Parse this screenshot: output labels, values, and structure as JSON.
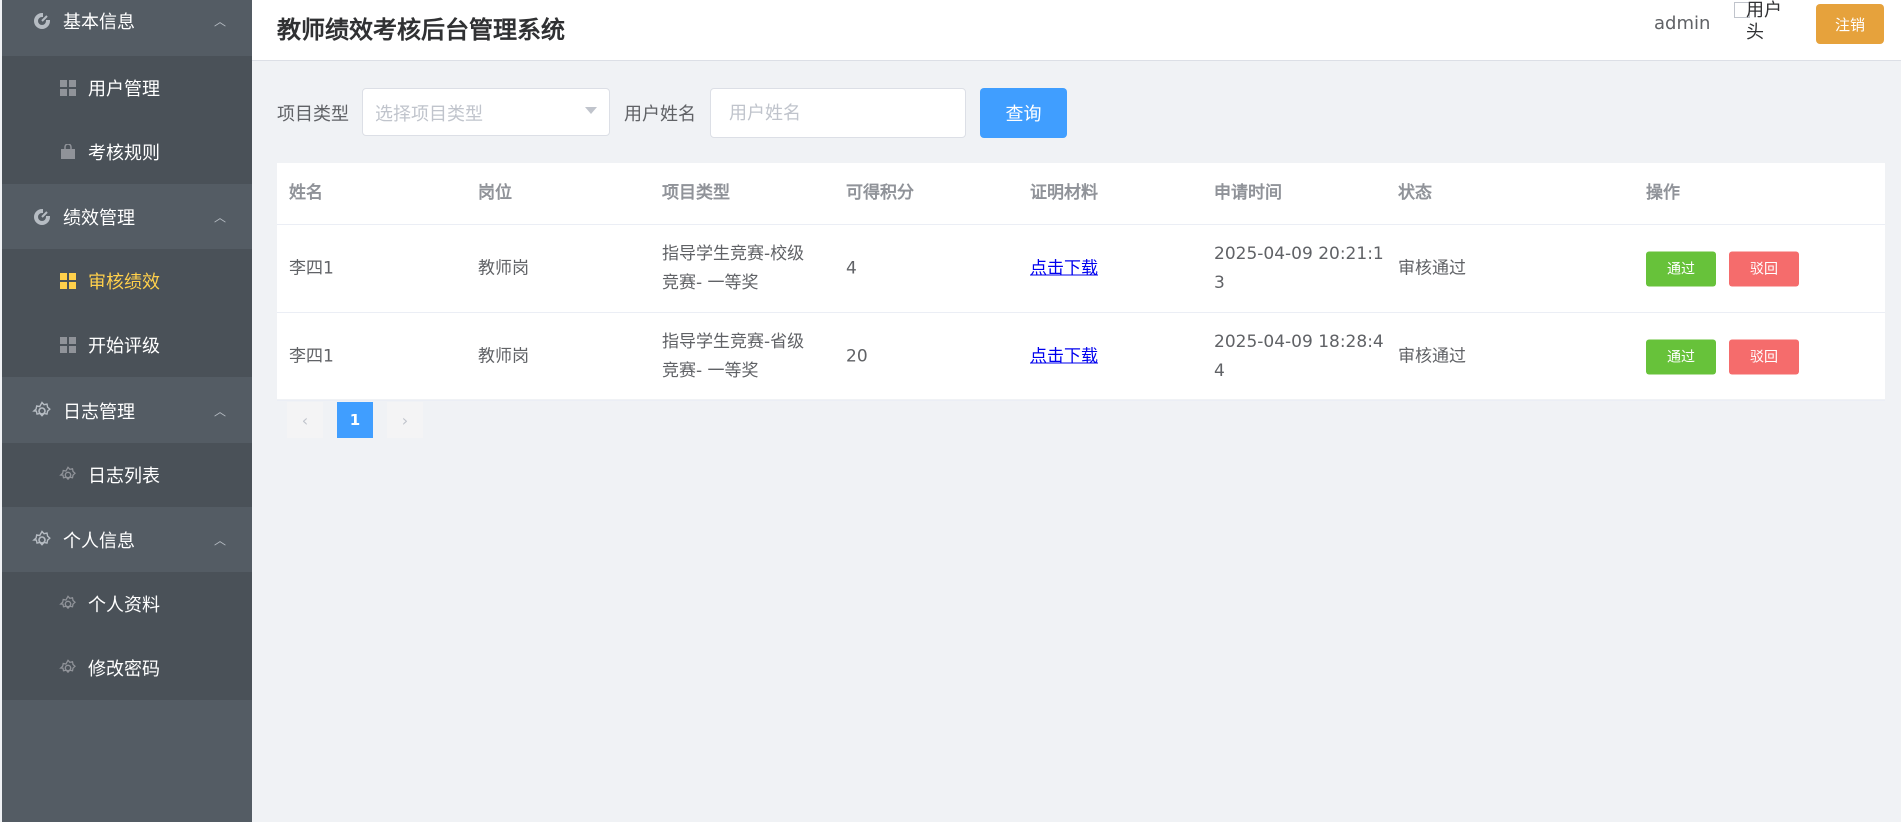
{
  "header": {
    "title": "教师绩效考核后台管理系统",
    "username": "admin",
    "avatar_alt": "用户头",
    "logout_label": "注销"
  },
  "sidebar": {
    "groups": [
      {
        "label": "基本信息",
        "icon": "chart-icon",
        "items": [
          {
            "label": "用户管理",
            "icon": "grid-icon"
          },
          {
            "label": "考核规则",
            "icon": "bag-icon"
          }
        ]
      },
      {
        "label": "绩效管理",
        "icon": "chart-icon",
        "items": [
          {
            "label": "审核绩效",
            "icon": "grid-icon",
            "active": true
          },
          {
            "label": "开始评级",
            "icon": "grid-icon"
          }
        ]
      },
      {
        "label": "日志管理",
        "icon": "gear-icon",
        "items": [
          {
            "label": "日志列表",
            "icon": "gear-icon"
          }
        ]
      },
      {
        "label": "个人信息",
        "icon": "gear-icon",
        "items": [
          {
            "label": "个人资料",
            "icon": "gear-icon"
          },
          {
            "label": "修改密码",
            "icon": "gear-icon"
          }
        ]
      }
    ],
    "active_color": "#ffd04b"
  },
  "filters": {
    "project_type_label": "项目类型",
    "project_type_placeholder": "选择项目类型",
    "user_name_label": "用户姓名",
    "user_name_placeholder": "用户姓名",
    "search_label": "查询"
  },
  "table": {
    "columns": [
      "姓名",
      "岗位",
      "项目类型",
      "可得积分",
      "证明材料",
      "申请时间",
      "状态",
      "操作"
    ],
    "rows": [
      {
        "name": "李四1",
        "position": "教师岗",
        "project_line1": "指导学生竞赛-校级",
        "project_line2": "竞赛- 一等奖",
        "points": "4",
        "proof": "点击下载",
        "time_line1": "2025-04-09 20:21:1",
        "time_line2": "3",
        "status": "审核通过",
        "pass_label": "通过",
        "reject_label": "驳回"
      },
      {
        "name": "李四1",
        "position": "教师岗",
        "project_line1": "指导学生竞赛-省级",
        "project_line2": "竞赛- 一等奖",
        "points": "20",
        "proof": "点击下载",
        "time_line1": "2025-04-09 18:28:4",
        "time_line2": "4",
        "status": "审核通过",
        "pass_label": "通过",
        "reject_label": "驳回"
      }
    ]
  },
  "pagination": {
    "prev": "‹",
    "current_page": "1",
    "next": "›"
  },
  "colors": {
    "sidebar_bg": "#545c64",
    "primary": "#409eff",
    "success": "#67c23a",
    "danger": "#f56c6c",
    "warning": "#e6a23c"
  }
}
